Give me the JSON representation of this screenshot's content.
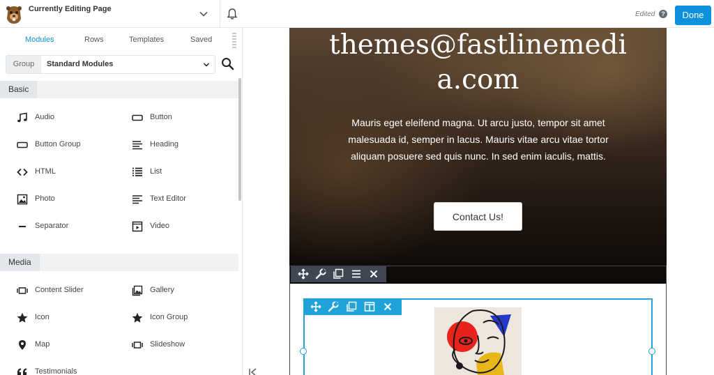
{
  "topbar": {
    "page_title": "Currently Editing Page",
    "edited_label": "Edited",
    "help_label": "?",
    "done_label": "Done"
  },
  "panel": {
    "tabs": [
      {
        "label": "Modules",
        "active": true
      },
      {
        "label": "Rows",
        "active": false
      },
      {
        "label": "Templates",
        "active": false
      },
      {
        "label": "Saved",
        "active": false
      }
    ],
    "group_label": "Group",
    "group_value": "Standard Modules",
    "sections": [
      {
        "title": "Basic",
        "modules": [
          {
            "label": "Audio",
            "icon": "music-note-icon"
          },
          {
            "label": "Button",
            "icon": "button-rect-icon"
          },
          {
            "label": "Button Group",
            "icon": "button-rect-icon"
          },
          {
            "label": "Heading",
            "icon": "heading-lines-icon"
          },
          {
            "label": "HTML",
            "icon": "code-brackets-icon"
          },
          {
            "label": "List",
            "icon": "list-icon"
          },
          {
            "label": "Photo",
            "icon": "photo-icon"
          },
          {
            "label": "Text Editor",
            "icon": "text-lines-icon"
          },
          {
            "label": "Separator",
            "icon": "separator-line-icon"
          },
          {
            "label": "Video",
            "icon": "video-icon"
          }
        ]
      },
      {
        "title": "Media",
        "modules": [
          {
            "label": "Content Slider",
            "icon": "slider-icon"
          },
          {
            "label": "Gallery",
            "icon": "gallery-icon"
          },
          {
            "label": "Icon",
            "icon": "star-icon"
          },
          {
            "label": "Icon Group",
            "icon": "star-icon"
          },
          {
            "label": "Map",
            "icon": "map-pin-icon"
          },
          {
            "label": "Slideshow",
            "icon": "slider-icon"
          },
          {
            "label": "Testimonials",
            "icon": "quote-icon"
          }
        ]
      }
    ]
  },
  "canvas": {
    "hero_email_line1": "themes@fastlinemedi",
    "hero_email_line2": "a.com",
    "hero_text": "Mauris eget eleifend magna. Ut arcu justo, tempor sit amet malesuada id, semper in lacus. Mauris vitae arcu vitae tortor aliquam posuere sed quis nunc. In sed enim iaculis, mattis.",
    "contact_label": "Contact Us!"
  },
  "colors": {
    "accent": "#0e91dc",
    "module_outline": "#1fa3d9",
    "row_toolbar": "#3e4752"
  }
}
